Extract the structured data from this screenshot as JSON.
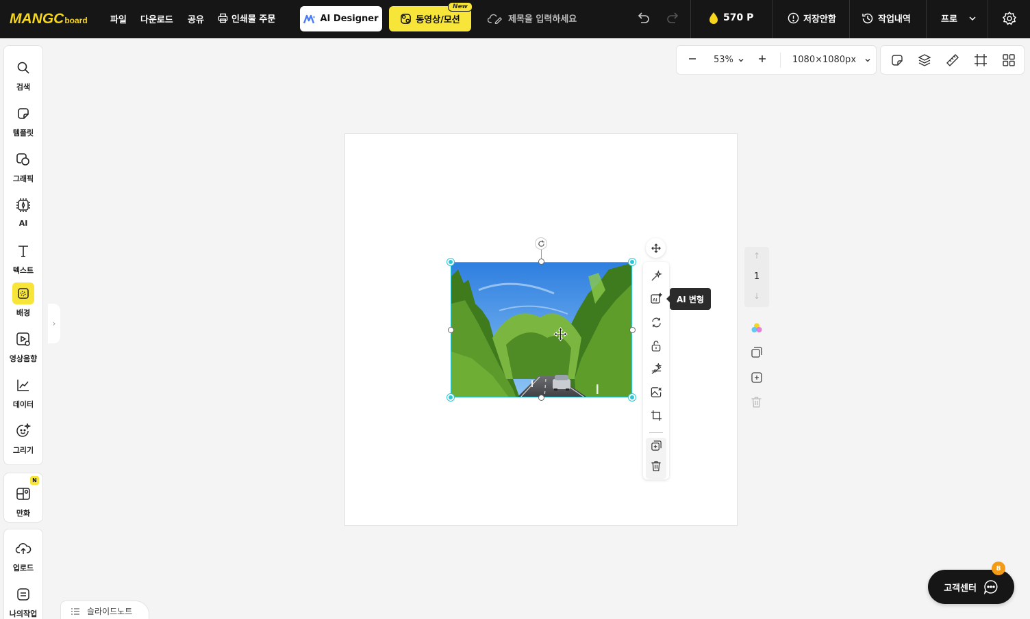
{
  "brand": {
    "logo_big": "MANGC",
    "logo_small": "board",
    "accent": "#f7e53a",
    "selection_color": "#2cc7d5"
  },
  "menu": {
    "file": "파일",
    "download": "다운로드",
    "share": "공유",
    "print_order": "인쇄물 주문"
  },
  "header": {
    "ai_designer": "AI Designer",
    "video_motion": "동영상/모션",
    "new_badge": "New",
    "title_placeholder": "제목을 입력하세요",
    "points": "570 P",
    "save_status": "저장안함",
    "history": "작업내역",
    "plan": "프로"
  },
  "sidebar": {
    "items": [
      {
        "label": "검색",
        "icon": "search-icon"
      },
      {
        "label": "템플릿",
        "icon": "template-icon"
      },
      {
        "label": "그래픽",
        "icon": "graphic-icon"
      },
      {
        "label": "AI",
        "icon": "ai-chip-icon"
      },
      {
        "label": "텍스트",
        "icon": "text-icon"
      },
      {
        "label": "배경",
        "icon": "background-icon",
        "active": true
      },
      {
        "label": "영상음향",
        "icon": "media-icon"
      },
      {
        "label": "데이터",
        "icon": "chart-icon"
      },
      {
        "label": "그리기",
        "icon": "draw-icon"
      }
    ],
    "comic": {
      "label": "만화",
      "badge": "N"
    },
    "upload": {
      "label": "업로드"
    },
    "my_work": {
      "label": "나의작업"
    }
  },
  "canvas_toolbar": {
    "zoom": "53%",
    "size": "1080×1080px"
  },
  "object_toolbar": {
    "tooltip": "AI 변형"
  },
  "page_nav": {
    "current": "1"
  },
  "bottom": {
    "slide_note": "슬라이드노트",
    "customer_center": "고객센터",
    "notification_count": "8"
  }
}
